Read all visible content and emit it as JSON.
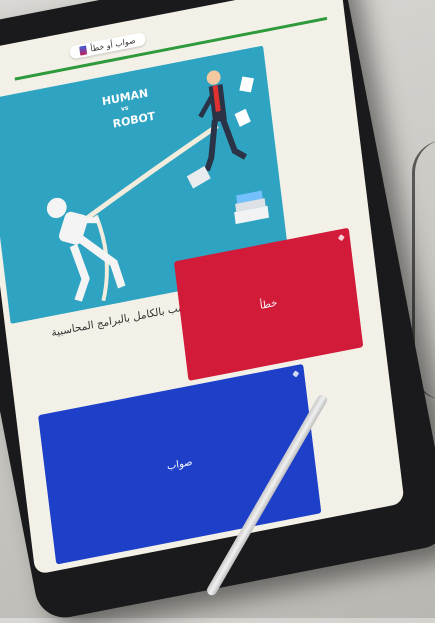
{
  "header": {
    "title": "صواب أو خطأ"
  },
  "illustration": {
    "line1": "HUMAN",
    "line2": "vs",
    "line3": "ROBOT"
  },
  "question": {
    "text": "يمكن ان يتم استبدال منصب المحاسب بالكامل بالبرامج المحاسبية"
  },
  "answers": [
    {
      "label": "خطأ",
      "color": "#d21a39"
    },
    {
      "label": "صواب",
      "color": "#1e40c8"
    }
  ],
  "colors": {
    "progress": "#2e9a3c",
    "illustration_bg": "#2ea3c2"
  }
}
